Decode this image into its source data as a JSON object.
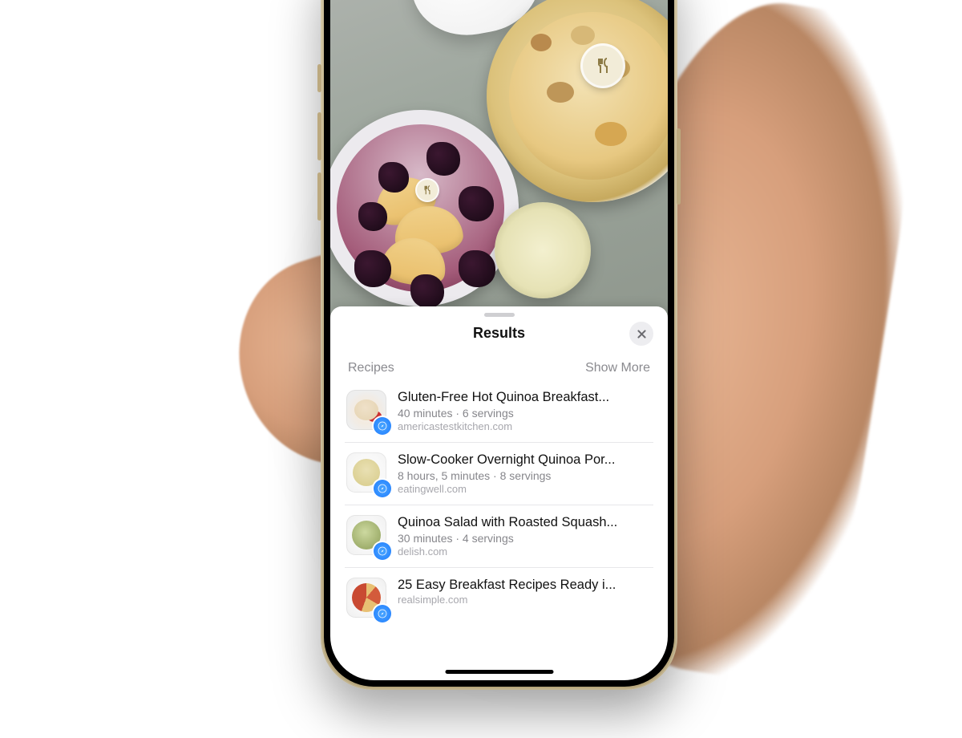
{
  "sheet": {
    "title": "Results",
    "close_icon": "close-icon",
    "section_title": "Recipes",
    "show_more": "Show More"
  },
  "lookup_badges": [
    {
      "id": "bowl-right-badge",
      "icon": "utensils-icon"
    },
    {
      "id": "bowl-left-badge",
      "icon": "utensils-icon"
    }
  ],
  "results": [
    {
      "title": "Gluten-Free Hot Quinoa Breakfast...",
      "subtitle": "40 minutes · 6 servings",
      "source": "americastestkitchen.com"
    },
    {
      "title": "Slow-Cooker Overnight Quinoa Por...",
      "subtitle": "8 hours, 5 minutes · 8 servings",
      "source": "eatingwell.com"
    },
    {
      "title": "Quinoa Salad with Roasted Squash...",
      "subtitle": "30 minutes · 4 servings",
      "source": "delish.com"
    },
    {
      "title": "25 Easy Breakfast Recipes Ready i...",
      "subtitle": "",
      "source": "realsimple.com"
    }
  ]
}
